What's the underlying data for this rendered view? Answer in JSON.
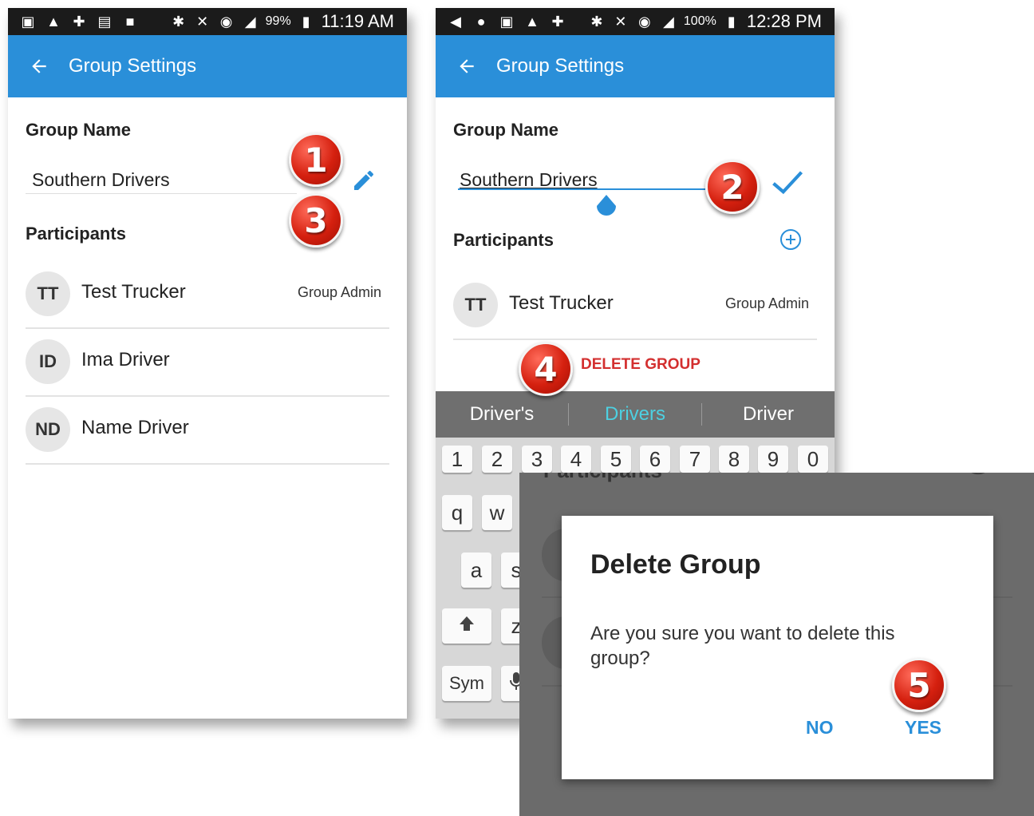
{
  "screen1": {
    "status": {
      "battery": "99%",
      "time": "11:19 AM"
    },
    "appbar": {
      "title": "Group Settings"
    },
    "group_name_label": "Group Name",
    "group_name_value": "Southern Drivers",
    "participants_label": "Participants",
    "participants": [
      {
        "initials": "TT",
        "name": "Test Trucker",
        "role": "Group Admin"
      },
      {
        "initials": "ID",
        "name": "Ima Driver",
        "role": ""
      },
      {
        "initials": "ND",
        "name": "Name Driver",
        "role": ""
      }
    ]
  },
  "screen2": {
    "status": {
      "battery": "100%",
      "time": "12:28 PM"
    },
    "appbar": {
      "title": "Group Settings"
    },
    "group_name_label": "Group Name",
    "group_name_value": "Southern Drivers",
    "participants_label": "Participants",
    "participants": [
      {
        "initials": "TT",
        "name": "Test Trucker",
        "role": "Group Admin"
      }
    ],
    "delete_group_label": "DELETE GROUP",
    "keyboard": {
      "suggestions": [
        "Driver's",
        "Drivers",
        "Driver"
      ],
      "number_keys": [
        "1",
        "2",
        "3",
        "4",
        "5",
        "6",
        "7",
        "8",
        "9",
        "0"
      ],
      "row2_keys": [
        "q",
        "w"
      ],
      "row3_keys": [
        "a",
        "s"
      ],
      "row4_keys": [
        "z"
      ],
      "sym_label": "Sym"
    }
  },
  "dialog": {
    "title": "Delete Group",
    "message": "Are you sure you want to delete this group?",
    "no_label": "NO",
    "yes_label": "YES",
    "behind_text": "Participants"
  },
  "steps": [
    "1",
    "2",
    "3",
    "4",
    "5"
  ],
  "colors": {
    "appbar": "#2a8fd9",
    "statusbar": "#1b1b1b",
    "delete": "#d32f2f",
    "suggest_active": "#4dd0e1",
    "badge": "#d5200f"
  }
}
